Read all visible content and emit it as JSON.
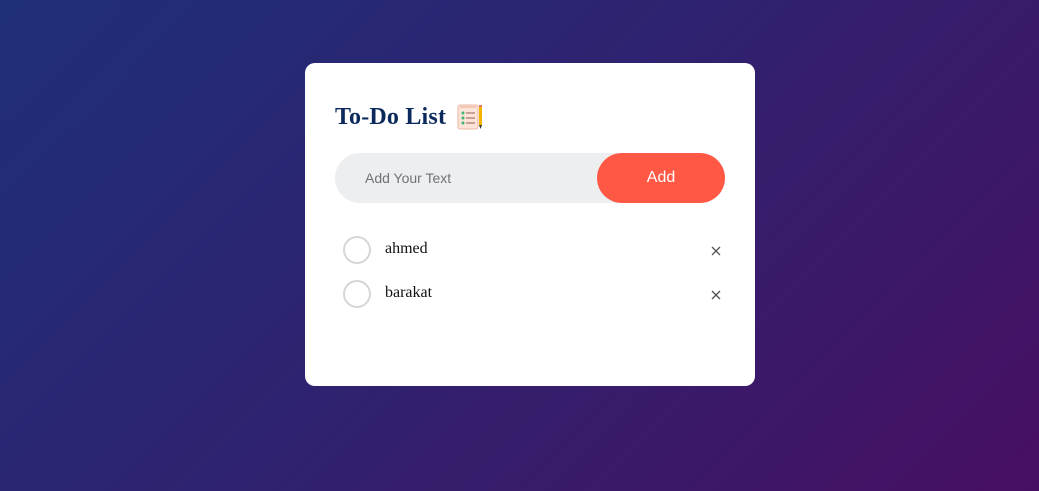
{
  "app": {
    "title": "To-Do List",
    "title_icon": "checklist-notepad-icon"
  },
  "input": {
    "placeholder": "Add Your Text",
    "value": ""
  },
  "add_button": {
    "label": "Add"
  },
  "tasks": [
    {
      "text": "ahmed",
      "checked": false
    },
    {
      "text": "barakat",
      "checked": false
    }
  ],
  "colors": {
    "accent": "#ff5945",
    "title": "#0b2a5b",
    "background_start": "#1f2f78",
    "background_end": "#470f63"
  }
}
